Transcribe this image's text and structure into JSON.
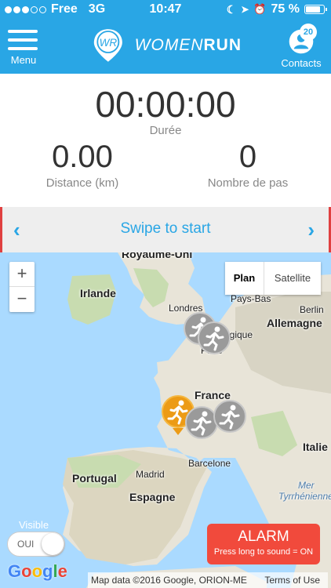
{
  "status_bar": {
    "carrier": "Free",
    "network": "3G",
    "time": "10:47",
    "battery": "75 %",
    "icons": [
      "moon-icon",
      "location-arrow-icon",
      "alarm-clock-icon",
      "battery-icon"
    ]
  },
  "header": {
    "menu_label": "Menu",
    "logo_text_light": "WOMEN",
    "logo_text_bold": "RUN",
    "logo_initials": "WR",
    "contacts_label": "Contacts",
    "contacts_count": "20"
  },
  "stats": {
    "duration_value": "00:00:00",
    "duration_label": "Durée",
    "distance_value": "0.00",
    "distance_label": "Distance (km)",
    "steps_value": "0",
    "steps_label": "Nombre de pas"
  },
  "swipe": {
    "text": "Swipe to start",
    "left_chevron": "‹",
    "right_chevron": "›"
  },
  "map": {
    "zoom_in": "+",
    "zoom_out": "−",
    "type_plan": "Plan",
    "type_satellite": "Satellite",
    "labels": {
      "royaume_uni": "Royaume-Uni",
      "irlande": "Irlande",
      "londres": "Londres",
      "pays_bas": "Pays-Bas",
      "berlin": "Berlin",
      "allemagne": "Allemagne",
      "belgique": "lgique",
      "paris": "Paris",
      "france": "France",
      "portugal": "Portugal",
      "madrid": "Madrid",
      "espagne": "Espagne",
      "barcelone": "Barcelone",
      "italie": "Italie",
      "mer": "Mer",
      "tyrrhenienne": "Tyrrhénienne"
    },
    "colors": {
      "water": "#aadaff",
      "land": "#e8e4d8",
      "green": "#c8dcb0",
      "runner_gray": "#9a9a9a",
      "runner_orange": "#ec9b16"
    },
    "visible_label": "Visible",
    "toggle_label": "OUI",
    "alarm_title": "ALARM",
    "alarm_sub": "Press long to sound = ON",
    "google_logo": "Google",
    "map_data": "Map data ©2016 Google, ORION-ME",
    "terms": "Terms of Use"
  },
  "accent_color": "#29a6e5"
}
